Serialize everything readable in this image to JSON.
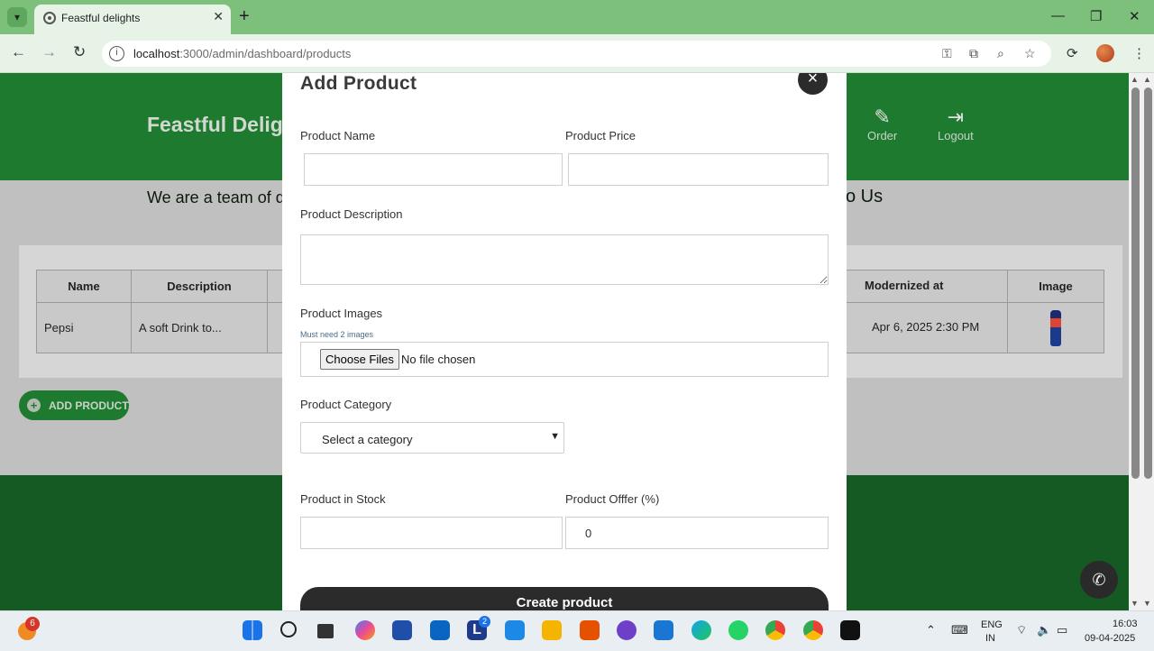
{
  "browser": {
    "tab_title": "Feastful delights",
    "url_host": "localhost",
    "url_rest": ":3000/admin/dashboard/products"
  },
  "header": {
    "brand": "Feastful Delig",
    "nav": [
      {
        "label": "Order",
        "icon": "pencil-icon"
      },
      {
        "label": "Logout",
        "icon": "logout-icon"
      }
    ]
  },
  "table": {
    "columns": [
      "Name",
      "Description",
      "Modernized at",
      "Image"
    ],
    "rows": [
      {
        "name": "Pepsi",
        "description": "A soft Drink to...",
        "modernized": "Apr 6, 2025 2:30 PM"
      }
    ]
  },
  "add_product_label": "ADD PRODUCT",
  "footer": {
    "left_text": "We are a team of de",
    "right_text": "o Us"
  },
  "modal": {
    "title": "Add Product",
    "close_label": "×",
    "fields": {
      "name_label": "Product Name",
      "price_label": "Product Price",
      "description_label": "Product Description",
      "images_label": "Product Images",
      "images_hint": "Must need 2 images",
      "choose_files": "Choose Files",
      "no_file": "No file chosen",
      "category_label": "Product Category",
      "category_value": "Select a category",
      "stock_label": "Product in Stock",
      "offer_label": "Product Offfer (%)",
      "offer_value": "0"
    },
    "submit_label": "Create product"
  },
  "taskbar": {
    "notification_count": "6",
    "lang_top": "ENG",
    "lang_bottom": "IN",
    "time": "16:03",
    "date": "09-04-2025",
    "l_badge": "2"
  },
  "colors": {
    "header_green": "#1e7a2e",
    "footer_green": "#145a22",
    "chrome_green": "#7cc07c",
    "modal_button": "#2b2b2b"
  }
}
